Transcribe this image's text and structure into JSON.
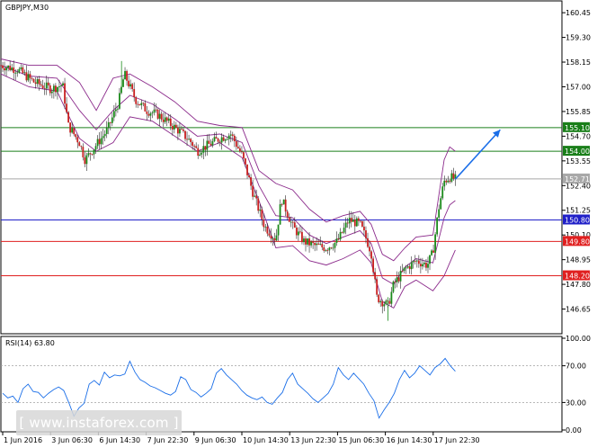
{
  "chart_data": [
    {
      "type": "candlestick",
      "title": "GBPJPY,M30",
      "ylim": [
        145.5,
        161.0
      ],
      "y_ticks": [
        160.45,
        159.3,
        158.15,
        157.0,
        155.85,
        154.7,
        153.55,
        152.4,
        151.25,
        150.1,
        148.95,
        147.8,
        146.65
      ],
      "x_ticks": [
        "1 Jun 2016",
        "3 Jun 06:30",
        "6 Jun 14:30",
        "7 Jun 22:30",
        "9 Jun 06:30",
        "10 Jun 14:30",
        "13 Jun 22:30",
        "15 Jun 06:30",
        "16 Jun 14:30",
        "17 Jun 22:30"
      ],
      "series": [
        {
          "name": "",
          "type": "candlestick",
          "x_range": [
            0,
            100
          ],
          "close_path": [
            [
              0,
              158.0
            ],
            [
              3,
              157.8
            ],
            [
              6,
              157.2
            ],
            [
              9,
              156.9
            ],
            [
              11,
              157.1
            ],
            [
              12,
              155.2
            ],
            [
              14,
              154.4
            ],
            [
              15,
              153.6
            ],
            [
              17,
              154.3
            ],
            [
              19,
              155.0
            ],
            [
              21,
              156.3
            ],
            [
              22,
              157.6
            ],
            [
              24,
              156.4
            ],
            [
              26,
              155.9
            ],
            [
              28,
              155.7
            ],
            [
              30,
              155.3
            ],
            [
              32,
              154.9
            ],
            [
              34,
              154.4
            ],
            [
              35,
              154.0
            ],
            [
              37,
              154.3
            ],
            [
              39,
              154.6
            ],
            [
              41,
              154.8
            ],
            [
              43,
              153.8
            ],
            [
              45,
              152.0
            ],
            [
              47,
              150.5
            ],
            [
              49,
              149.9
            ],
            [
              50,
              151.8
            ],
            [
              52,
              150.5
            ],
            [
              54,
              149.8
            ],
            [
              56,
              149.6
            ],
            [
              58,
              149.5
            ],
            [
              60,
              149.8
            ],
            [
              62,
              150.8
            ],
            [
              64,
              150.6
            ],
            [
              65,
              150.0
            ],
            [
              66,
              149.3
            ],
            [
              67,
              147.2
            ],
            [
              68,
              147.0
            ],
            [
              69,
              146.8
            ],
            [
              70,
              147.8
            ],
            [
              72,
              148.5
            ],
            [
              74,
              148.9
            ],
            [
              76,
              148.7
            ],
            [
              77,
              149.3
            ],
            [
              78,
              151.3
            ],
            [
              79,
              152.6
            ],
            [
              80,
              152.8
            ],
            [
              81,
              152.7
            ]
          ],
          "high": 158.2,
          "low": 146.1
        },
        {
          "name": "",
          "type": "bollinger_upper",
          "x_range": [
            0,
            100
          ],
          "path": [
            [
              0,
              158.3
            ],
            [
              5,
              158.0
            ],
            [
              10,
              158.0
            ],
            [
              14,
              157.2
            ],
            [
              17,
              155.9
            ],
            [
              20,
              157.4
            ],
            [
              23,
              157.6
            ],
            [
              27,
              157.0
            ],
            [
              31,
              156.3
            ],
            [
              35,
              155.4
            ],
            [
              39,
              155.2
            ],
            [
              43,
              155.1
            ],
            [
              46,
              153.1
            ],
            [
              49,
              152.5
            ],
            [
              52,
              152.2
            ],
            [
              55,
              151.3
            ],
            [
              58,
              150.7
            ],
            [
              61,
              151.0
            ],
            [
              64,
              151.2
            ],
            [
              66,
              150.6
            ],
            [
              68,
              149.2
            ],
            [
              70,
              148.9
            ],
            [
              72,
              149.5
            ],
            [
              74,
              150.0
            ],
            [
              77,
              150.1
            ],
            [
              79,
              153.6
            ],
            [
              80,
              154.2
            ],
            [
              81,
              154.0
            ]
          ]
        },
        {
          "name": "",
          "type": "bollinger_middle",
          "x_range": [
            0,
            100
          ],
          "path": [
            [
              0,
              158.0
            ],
            [
              5,
              157.5
            ],
            [
              10,
              157.4
            ],
            [
              14,
              155.9
            ],
            [
              17,
              155.0
            ],
            [
              20,
              155.9
            ],
            [
              23,
              156.6
            ],
            [
              27,
              156.2
            ],
            [
              31,
              155.5
            ],
            [
              35,
              154.7
            ],
            [
              39,
              154.8
            ],
            [
              43,
              154.4
            ],
            [
              46,
              152.4
            ],
            [
              49,
              151.0
            ],
            [
              52,
              150.9
            ],
            [
              55,
              150.1
            ],
            [
              58,
              149.7
            ],
            [
              61,
              150.0
            ],
            [
              64,
              150.3
            ],
            [
              66,
              149.7
            ],
            [
              68,
              148.1
            ],
            [
              70,
              147.8
            ],
            [
              72,
              148.6
            ],
            [
              74,
              149.0
            ],
            [
              77,
              148.8
            ],
            [
              79,
              150.9
            ],
            [
              80,
              151.5
            ],
            [
              81,
              151.7
            ]
          ]
        },
        {
          "name": "",
          "type": "bollinger_lower",
          "x_range": [
            0,
            100
          ],
          "path": [
            [
              0,
              157.6
            ],
            [
              5,
              157.0
            ],
            [
              10,
              156.8
            ],
            [
              14,
              154.6
            ],
            [
              17,
              154.0
            ],
            [
              20,
              154.4
            ],
            [
              23,
              155.6
            ],
            [
              27,
              155.4
            ],
            [
              31,
              154.7
            ],
            [
              35,
              154.0
            ],
            [
              39,
              154.4
            ],
            [
              43,
              153.7
            ],
            [
              46,
              151.7
            ],
            [
              49,
              149.5
            ],
            [
              52,
              149.6
            ],
            [
              55,
              148.9
            ],
            [
              58,
              148.7
            ],
            [
              61,
              149.0
            ],
            [
              64,
              149.4
            ],
            [
              66,
              148.8
            ],
            [
              68,
              147.0
            ],
            [
              70,
              146.7
            ],
            [
              72,
              147.7
            ],
            [
              74,
              148.0
            ],
            [
              77,
              147.5
            ],
            [
              79,
              148.2
            ],
            [
              80,
              148.8
            ],
            [
              81,
              149.4
            ]
          ]
        }
      ],
      "horizontal_levels": [
        {
          "value": 155.1,
          "label": "155.10",
          "color": "#1a7f1a"
        },
        {
          "value": 154.0,
          "label": "154.00",
          "color": "#1a7f1a"
        },
        {
          "value": 152.71,
          "label": "152.71",
          "color": "#a8a8a8"
        },
        {
          "value": 150.8,
          "label": "150.80",
          "color": "#2020c8"
        },
        {
          "value": 149.8,
          "label": "149.80",
          "color": "#e02020"
        },
        {
          "value": 148.2,
          "label": "148.20",
          "color": "#e02020"
        }
      ],
      "annotations": [
        {
          "type": "arrow",
          "from": [
            81,
            152.7
          ],
          "to": [
            89,
            155.0
          ],
          "color": "#1a6ee8"
        }
      ],
      "colors": {
        "bull": "#1a8a1a",
        "bear": "#c82020",
        "bollinger": "#8b2a8b"
      }
    },
    {
      "type": "line",
      "title": "RSI(14) 63.80",
      "ylim": [
        0,
        100
      ],
      "y_ticks": [
        100.0,
        70.0,
        30.0,
        0.0
      ],
      "levels": [
        70,
        30
      ],
      "series": [
        {
          "name": "",
          "values": [
            40,
            35,
            37,
            30,
            45,
            50,
            42,
            41,
            35,
            40,
            44,
            47,
            43,
            30,
            15,
            24,
            29,
            50,
            54,
            49,
            63,
            57,
            60,
            59,
            61,
            75,
            63,
            55,
            52,
            48,
            46,
            43,
            40,
            38,
            42,
            58,
            55,
            44,
            41,
            36,
            40,
            45,
            62,
            67,
            60,
            55,
            50,
            43,
            38,
            35,
            33,
            36,
            30,
            28,
            35,
            41,
            55,
            62,
            50,
            45,
            40,
            34,
            30,
            35,
            40,
            50,
            68,
            60,
            55,
            62,
            56,
            50,
            40,
            32,
            13,
            22,
            30,
            40,
            55,
            65,
            57,
            62,
            70,
            65,
            60,
            68,
            72,
            78,
            70,
            64
          ],
          "color": "#1a6ee8"
        }
      ]
    }
  ],
  "watermark": "[ www.instaforex.com ]"
}
